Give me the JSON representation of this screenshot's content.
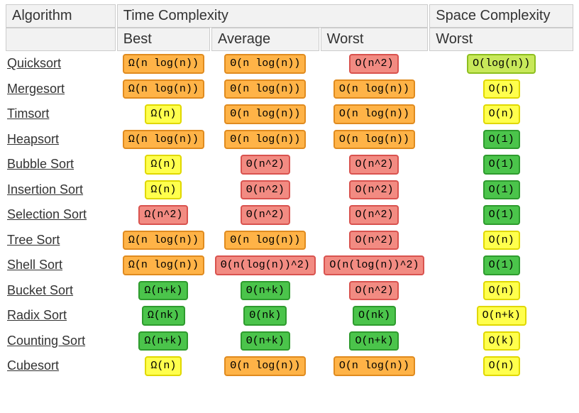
{
  "headers": {
    "algorithm": "Algorithm",
    "time": "Time Complexity",
    "space": "Space Complexity",
    "best": "Best",
    "average": "Average",
    "worst": "Worst",
    "space_worst": "Worst"
  },
  "rows": [
    {
      "name": "Quicksort",
      "best": {
        "text": "Ω(n log(n))",
        "cls": "orange"
      },
      "avg": {
        "text": "Θ(n log(n))",
        "cls": "orange"
      },
      "worst": {
        "text": "O(n^2)",
        "cls": "red"
      },
      "space": {
        "text": "O(log(n))",
        "cls": "yellow-green"
      }
    },
    {
      "name": "Mergesort",
      "best": {
        "text": "Ω(n log(n))",
        "cls": "orange"
      },
      "avg": {
        "text": "Θ(n log(n))",
        "cls": "orange"
      },
      "worst": {
        "text": "O(n log(n))",
        "cls": "orange"
      },
      "space": {
        "text": "O(n)",
        "cls": "yellow"
      }
    },
    {
      "name": "Timsort",
      "best": {
        "text": "Ω(n)",
        "cls": "yellow"
      },
      "avg": {
        "text": "Θ(n log(n))",
        "cls": "orange"
      },
      "worst": {
        "text": "O(n log(n))",
        "cls": "orange"
      },
      "space": {
        "text": "O(n)",
        "cls": "yellow"
      }
    },
    {
      "name": "Heapsort",
      "best": {
        "text": "Ω(n log(n))",
        "cls": "orange"
      },
      "avg": {
        "text": "Θ(n log(n))",
        "cls": "orange"
      },
      "worst": {
        "text": "O(n log(n))",
        "cls": "orange"
      },
      "space": {
        "text": "O(1)",
        "cls": "green"
      }
    },
    {
      "name": "Bubble Sort",
      "best": {
        "text": "Ω(n)",
        "cls": "yellow"
      },
      "avg": {
        "text": "Θ(n^2)",
        "cls": "red"
      },
      "worst": {
        "text": "O(n^2)",
        "cls": "red"
      },
      "space": {
        "text": "O(1)",
        "cls": "green"
      }
    },
    {
      "name": "Insertion Sort",
      "best": {
        "text": "Ω(n)",
        "cls": "yellow"
      },
      "avg": {
        "text": "Θ(n^2)",
        "cls": "red"
      },
      "worst": {
        "text": "O(n^2)",
        "cls": "red"
      },
      "space": {
        "text": "O(1)",
        "cls": "green"
      }
    },
    {
      "name": "Selection Sort",
      "best": {
        "text": "Ω(n^2)",
        "cls": "red"
      },
      "avg": {
        "text": "Θ(n^2)",
        "cls": "red"
      },
      "worst": {
        "text": "O(n^2)",
        "cls": "red"
      },
      "space": {
        "text": "O(1)",
        "cls": "green"
      }
    },
    {
      "name": "Tree Sort",
      "best": {
        "text": "Ω(n log(n))",
        "cls": "orange"
      },
      "avg": {
        "text": "Θ(n log(n))",
        "cls": "orange"
      },
      "worst": {
        "text": "O(n^2)",
        "cls": "red"
      },
      "space": {
        "text": "O(n)",
        "cls": "yellow"
      }
    },
    {
      "name": "Shell Sort",
      "best": {
        "text": "Ω(n log(n))",
        "cls": "orange"
      },
      "avg": {
        "text": "Θ(n(log(n))^2)",
        "cls": "red"
      },
      "worst": {
        "text": "O(n(log(n))^2)",
        "cls": "red"
      },
      "space": {
        "text": "O(1)",
        "cls": "green"
      }
    },
    {
      "name": "Bucket Sort",
      "best": {
        "text": "Ω(n+k)",
        "cls": "green"
      },
      "avg": {
        "text": "Θ(n+k)",
        "cls": "green"
      },
      "worst": {
        "text": "O(n^2)",
        "cls": "red"
      },
      "space": {
        "text": "O(n)",
        "cls": "yellow"
      }
    },
    {
      "name": "Radix Sort",
      "best": {
        "text": "Ω(nk)",
        "cls": "green"
      },
      "avg": {
        "text": "Θ(nk)",
        "cls": "green"
      },
      "worst": {
        "text": "O(nk)",
        "cls": "green"
      },
      "space": {
        "text": "O(n+k)",
        "cls": "yellow"
      }
    },
    {
      "name": "Counting Sort",
      "best": {
        "text": "Ω(n+k)",
        "cls": "green"
      },
      "avg": {
        "text": "Θ(n+k)",
        "cls": "green"
      },
      "worst": {
        "text": "O(n+k)",
        "cls": "green"
      },
      "space": {
        "text": "O(k)",
        "cls": "yellow"
      }
    },
    {
      "name": "Cubesort",
      "best": {
        "text": "Ω(n)",
        "cls": "yellow"
      },
      "avg": {
        "text": "Θ(n log(n))",
        "cls": "orange"
      },
      "worst": {
        "text": "O(n log(n))",
        "cls": "orange"
      },
      "space": {
        "text": "O(n)",
        "cls": "yellow"
      }
    }
  ]
}
